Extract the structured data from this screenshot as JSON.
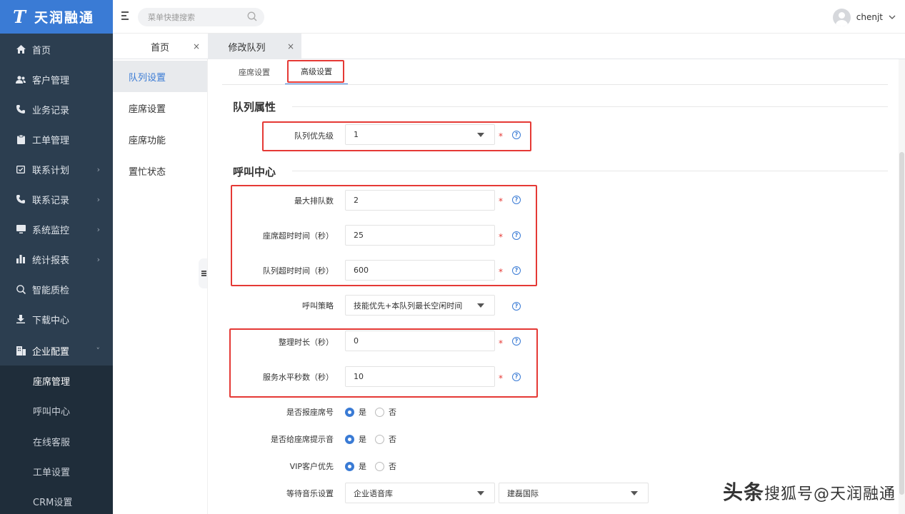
{
  "brand": {
    "logo_mark": "T",
    "name": "天润融通"
  },
  "sidebar": {
    "items": [
      {
        "label": "首页",
        "icon": "home-icon",
        "glyph": "⌂"
      },
      {
        "label": "客户管理",
        "icon": "users-icon",
        "glyph": "👥"
      },
      {
        "label": "业务记录",
        "icon": "phone-icon",
        "glyph": "✆"
      },
      {
        "label": "工单管理",
        "icon": "clipboard-icon",
        "glyph": "▣"
      },
      {
        "label": "联系计划",
        "icon": "calendar-check-icon",
        "glyph": "☑"
      },
      {
        "label": "联系记录",
        "icon": "phone-icon",
        "glyph": "✆"
      },
      {
        "label": "系统监控",
        "icon": "monitor-icon",
        "glyph": "▭"
      },
      {
        "label": "统计报表",
        "icon": "bar-chart-icon",
        "glyph": "▥"
      },
      {
        "label": "智能质检",
        "icon": "search-icon",
        "glyph": "⊙"
      },
      {
        "label": "下载中心",
        "icon": "download-icon",
        "glyph": "⤓"
      },
      {
        "label": "企业配置",
        "icon": "building-icon",
        "glyph": "▦"
      }
    ],
    "expand_glyph": "›",
    "collapse_glyph": "˅",
    "subitems": [
      {
        "label": "座席管理"
      },
      {
        "label": "呼叫中心"
      },
      {
        "label": "在线客服"
      },
      {
        "label": "工单设置"
      },
      {
        "label": "CRM设置"
      }
    ]
  },
  "header": {
    "search_placeholder": "菜单快捷搜索",
    "username": "chenjt",
    "user_chevron": "⌵"
  },
  "page_tabs": [
    {
      "label": "首页",
      "close": "×"
    },
    {
      "label": "修改队列",
      "close": "×"
    }
  ],
  "subnav": {
    "items": [
      {
        "label": "队列设置"
      },
      {
        "label": "座席设置"
      },
      {
        "label": "座席功能"
      },
      {
        "label": "置忙状态"
      }
    ]
  },
  "inner_tabs": [
    {
      "label": "座席设置"
    },
    {
      "label": "高级设置"
    }
  ],
  "sections": {
    "queue_props": "队列属性",
    "call_center": "呼叫中心"
  },
  "form": {
    "priority": {
      "label": "队列优先级",
      "value": "1"
    },
    "max_queue": {
      "label": "最大排队数",
      "value": "2"
    },
    "agent_timeout": {
      "label": "座席超时时间（秒）",
      "value": "25"
    },
    "queue_timeout": {
      "label": "队列超时时间（秒）",
      "value": "600"
    },
    "strategy": {
      "label": "呼叫策略",
      "value": "技能优先+本队列最长空闲时间"
    },
    "wrapup": {
      "label": "整理时长（秒）",
      "value": "0"
    },
    "service_level": {
      "label": "服务水平秒数（秒）",
      "value": "10"
    },
    "report_agent_no": {
      "label": "是否报座席号",
      "yes": "是",
      "no": "否",
      "selected": "yes"
    },
    "agent_tone": {
      "label": "是否给座席提示音",
      "yes": "是",
      "no": "否",
      "selected": "yes"
    },
    "vip_priority": {
      "label": "VIP客户优先",
      "yes": "是",
      "no": "否",
      "selected": "yes"
    },
    "hold_music": {
      "label": "等待音乐设置",
      "library": "企业语音库",
      "track": "建磊国际"
    }
  },
  "required_mark": "*",
  "help_glyph": "?",
  "watermark": {
    "line1": "头条",
    "line2": "搜狐号@天润融通"
  }
}
